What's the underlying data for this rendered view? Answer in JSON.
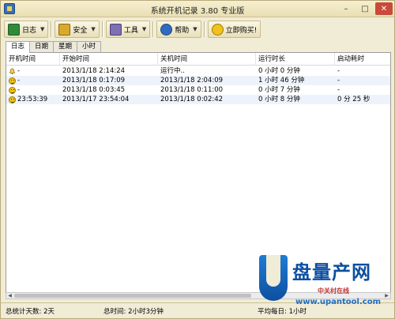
{
  "window": {
    "title": "系统开机记录 3.80 专业版",
    "controls": {
      "minimize": "–",
      "maximize": "□",
      "close": "✕"
    }
  },
  "toolbar": {
    "log_label": "日志",
    "security_label": "安全",
    "tools_label": "工具",
    "help_label": "帮助",
    "buy_label": "立即购买!"
  },
  "tabs": [
    "日志",
    "日期",
    "星期",
    "小时"
  ],
  "table": {
    "columns": [
      "开机时间",
      "开始时间",
      "关机时间",
      "运行时长",
      "启动耗时"
    ],
    "rows": [
      {
        "icon": "bell-icon",
        "boot": "-",
        "start": "2013/1/18 2:14:24",
        "shutdown": "运行中..",
        "duration": "0 小时  0 分钟",
        "startup": "-"
      },
      {
        "icon": "smiley-icon",
        "boot": "-",
        "start": "2013/1/18 0:17:09",
        "shutdown": "2013/1/18 2:04:09",
        "duration": "1 小时 46 分钟",
        "startup": "-"
      },
      {
        "icon": "smiley-icon",
        "boot": "-",
        "start": "2013/1/18 0:03:45",
        "shutdown": "2013/1/18 0:11:00",
        "duration": "0 小时  7 分钟",
        "startup": "-"
      },
      {
        "icon": "smiley-icon",
        "boot": "23:53:39",
        "start": "2013/1/17 23:54:04",
        "shutdown": "2013/1/18 0:02:42",
        "duration": "0 小时  8 分钟",
        "startup": "0 分 25 秒"
      }
    ]
  },
  "status": {
    "total_days": "总统计天数: 2天",
    "total_time": "总时间: 2小时3分钟",
    "average": "平均每日: 1小时"
  },
  "watermark": {
    "brand": "盘量产网",
    "sub": "中关村在线",
    "url": "www.upantool.com"
  },
  "colors": {
    "frame": "#f0ecd6",
    "row_highlight": "#eef3fb",
    "watermark_blue": "#0d4fa0"
  }
}
